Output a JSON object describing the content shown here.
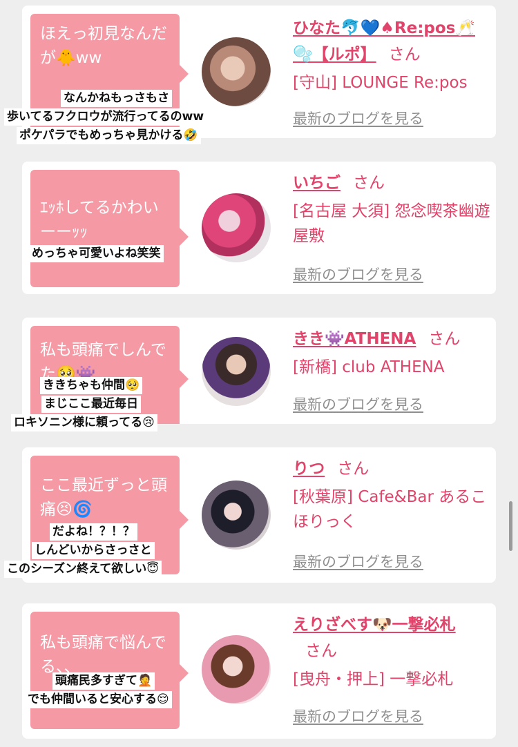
{
  "items": [
    {
      "bubble": "ほえっ初見なんだが🐥ww",
      "name": "ひなた🐬💙♠Re:pos🥂🫧【ルポ】",
      "san": "さん",
      "shop": "[守山] LOUNGE Re:pos",
      "blog": "最新のブログを見る",
      "captions": [
        "なんかねもっさもさ",
        "歩いてるフクロウが流行ってるのww",
        "ポケパラでもめっちゃ見かける🤣"
      ]
    },
    {
      "bubble": "ｴｯﾎしてるかわいーーｯｯ",
      "name": "いちご",
      "san": "さん",
      "shop": "[名古屋 大須] 怨念喫茶幽遊屋敷",
      "blog": "最新のブログを見る",
      "captions": [
        "めっちゃ可愛いよね笑笑"
      ]
    },
    {
      "bubble": "私も頭痛でしんでた🥺👾",
      "name": "きき👾ATHENA",
      "san": "さん",
      "shop": "[新橋] club ATHENA",
      "blog": "最新のブログを見る",
      "captions": [
        "ききちゃも仲間🥺",
        "まじここ最近毎日",
        "ロキソニン様に頼ってる😢"
      ]
    },
    {
      "bubble": "ここ最近ずっと頭痛😣🌀",
      "name": "りつ",
      "san": "さん",
      "shop": "[秋葉原] Cafe&Bar あるこほりっく",
      "blog": "最新のブログを見る",
      "captions": [
        "だよね！？！？",
        "しんどいからさっさと",
        "このシーズン終えて欲しい😇"
      ]
    },
    {
      "bubble": "私も頭痛で悩んでる、、",
      "name": "えりざべす🐶一撃必札",
      "san": "さん",
      "shop": "[曳舟・押上] 一撃必札",
      "blog": "最新のブログを見る",
      "captions": [
        "頭痛民多すぎて🤦",
        "でも仲間いると安心する😌"
      ]
    }
  ]
}
